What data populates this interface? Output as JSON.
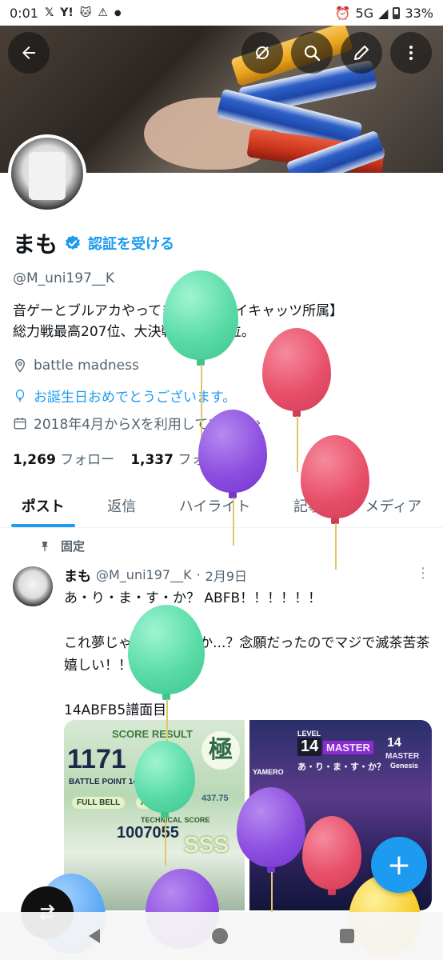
{
  "status_bar": {
    "time": "0:01",
    "notif_x": "𝕏",
    "notif_yahoo": "Y!",
    "network": "5G",
    "battery": "33%"
  },
  "profile": {
    "display_name": "まも",
    "verify_label": "認証を受ける",
    "handle": "@M_uni197__K",
    "bio_line1": "音ゲーとブルアカやってます。【アレイキャッツ所属】",
    "bio_line2": "総力戦最高207位、大決戦最高154位。",
    "location": "battle madness",
    "birthday": "お誕生日おめでとうございます。",
    "joined": "2018年4月からXを利用しています",
    "following_count": "1,269",
    "following_label": "フォロー",
    "followers_count": "1,337",
    "followers_label": "フォロワー"
  },
  "tabs": [
    {
      "label": "ポスト",
      "active": true
    },
    {
      "label": "返信",
      "active": false
    },
    {
      "label": "ハイライト",
      "active": false
    },
    {
      "label": "記事",
      "active": false
    },
    {
      "label": "メディア",
      "active": false
    }
  ],
  "post": {
    "pinned_label": "固定",
    "name": "まも",
    "handle": "@M_uni197__K",
    "sep": "·",
    "date": "2月9日",
    "text": "あ・り・ま・す・か？ ABFB！！！！！！\n\nこれ夢じゃないんですか...？念願だったのでマジで滅茶苦茶嬉しい！！！！\n\n14ABFB5譜面目",
    "media_a": {
      "score_label": "SCORE RESULT",
      "score": "1171",
      "battle_point": "BATTLE POINT 14,374",
      "full_bell": "FULL BELL",
      "all_break": "ALL BR",
      "rating": "437.75",
      "technical": "TECHNICAL SCORE",
      "tech_score": "1007055",
      "rank": "SSS",
      "kanji": "極"
    },
    "media_b": {
      "level_label": "LEVEL",
      "level": "14",
      "difficulty": "MASTER",
      "song": "あ・り・ま・す・か？",
      "artist": "YAMERO",
      "other_level": "14",
      "other_diff": "MASTER",
      "other_song": "Genesis"
    }
  },
  "colors": {
    "accent": "#1d9bf0",
    "text": "#0f1419",
    "muted": "#536471"
  }
}
